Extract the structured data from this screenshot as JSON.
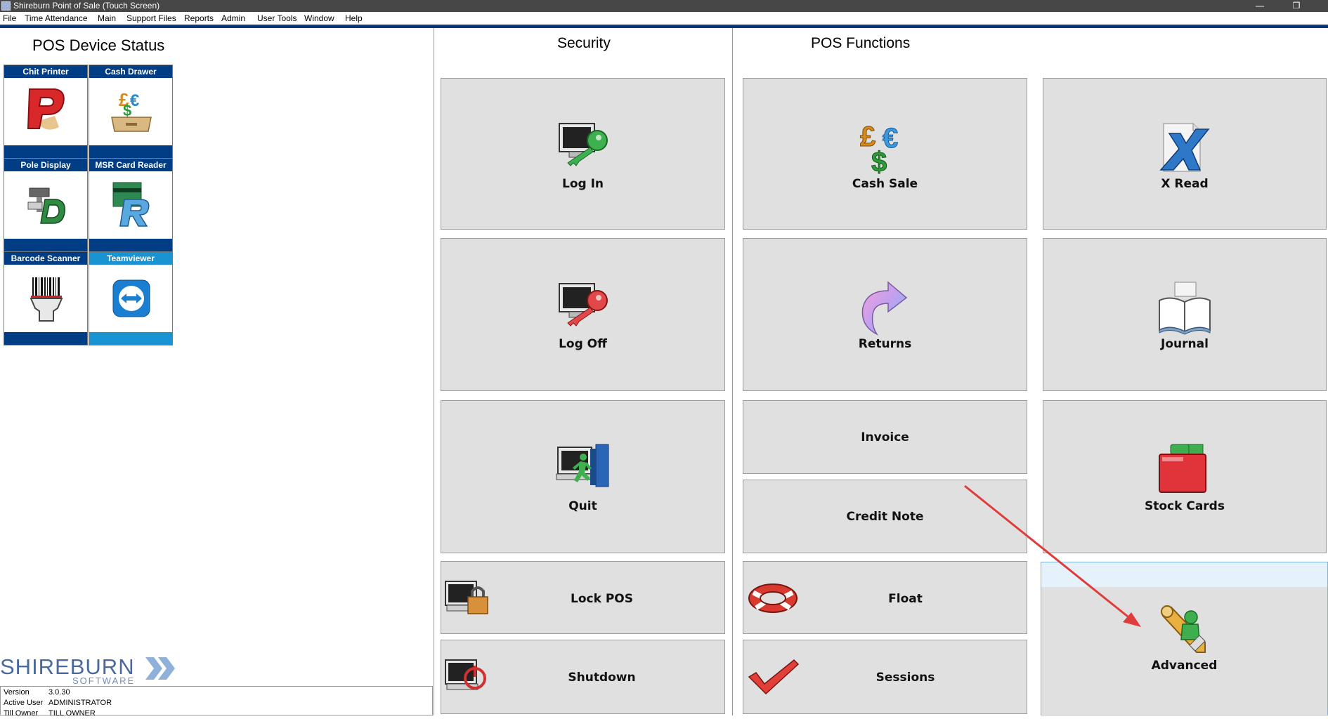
{
  "window": {
    "title": "Shireburn Point of Sale (Touch Screen)",
    "maximize_glyph": "❐",
    "minimize_glyph": "—"
  },
  "menu": [
    "File",
    "Time Attendance",
    "Main",
    "Support Files",
    "Reports",
    "Admin",
    "User Tools",
    "Window",
    "Help"
  ],
  "device_status": {
    "heading": "POS Device Status",
    "tiles": [
      {
        "label": "Chit Printer",
        "icon": "chit-printer-icon"
      },
      {
        "label": "Cash Drawer",
        "icon": "cash-drawer-icon"
      },
      {
        "label": "Pole Display",
        "icon": "pole-display-icon"
      },
      {
        "label": "MSR Card Reader",
        "icon": "msr-card-reader-icon"
      },
      {
        "label": "Barcode Scanner",
        "icon": "barcode-scanner-icon"
      },
      {
        "label": "Teamviewer",
        "icon": "teamviewer-icon"
      }
    ]
  },
  "logo": {
    "word": "SHIREBURN",
    "sub": "SOFTWARE"
  },
  "info": {
    "version_label": "Version",
    "version": "3.0.30",
    "user_label": "Active User",
    "user": "ADMINISTRATOR",
    "till_label": "Till Owner",
    "till": "TILL OWNER"
  },
  "security": {
    "heading": "Security",
    "buttons": [
      {
        "label": "Log In",
        "icon": "log-in-icon"
      },
      {
        "label": "Log Off",
        "icon": "log-off-icon"
      },
      {
        "label": "Quit",
        "icon": "quit-icon"
      },
      {
        "label": "Lock POS",
        "icon": "lock-icon"
      },
      {
        "label": "Shutdown",
        "icon": "shutdown-icon"
      }
    ]
  },
  "functions": {
    "heading": "POS Functions",
    "buttons": [
      {
        "label": "Cash Sale",
        "icon": "currency-icon"
      },
      {
        "label": "X Read",
        "icon": "x-read-icon"
      },
      {
        "label": "Returns",
        "icon": "return-arrow-icon"
      },
      {
        "label": "Journal",
        "icon": "journal-book-icon"
      },
      {
        "label": "Invoice"
      },
      {
        "label": "Credit Note"
      },
      {
        "label": "Stock Cards",
        "icon": "stock-cards-icon"
      },
      {
        "label": "Float",
        "icon": "lifebuoy-icon"
      },
      {
        "label": "Sessions",
        "icon": "checkmark-icon"
      },
      {
        "label": "Advanced",
        "icon": "advanced-tools-icon"
      }
    ]
  },
  "colors": {
    "accent": "#003d85",
    "teamviewer": "#1a93d3",
    "button_bg": "#e0e0e0",
    "highlight": "#e5f1fb",
    "arrow": "#e03c3c"
  }
}
